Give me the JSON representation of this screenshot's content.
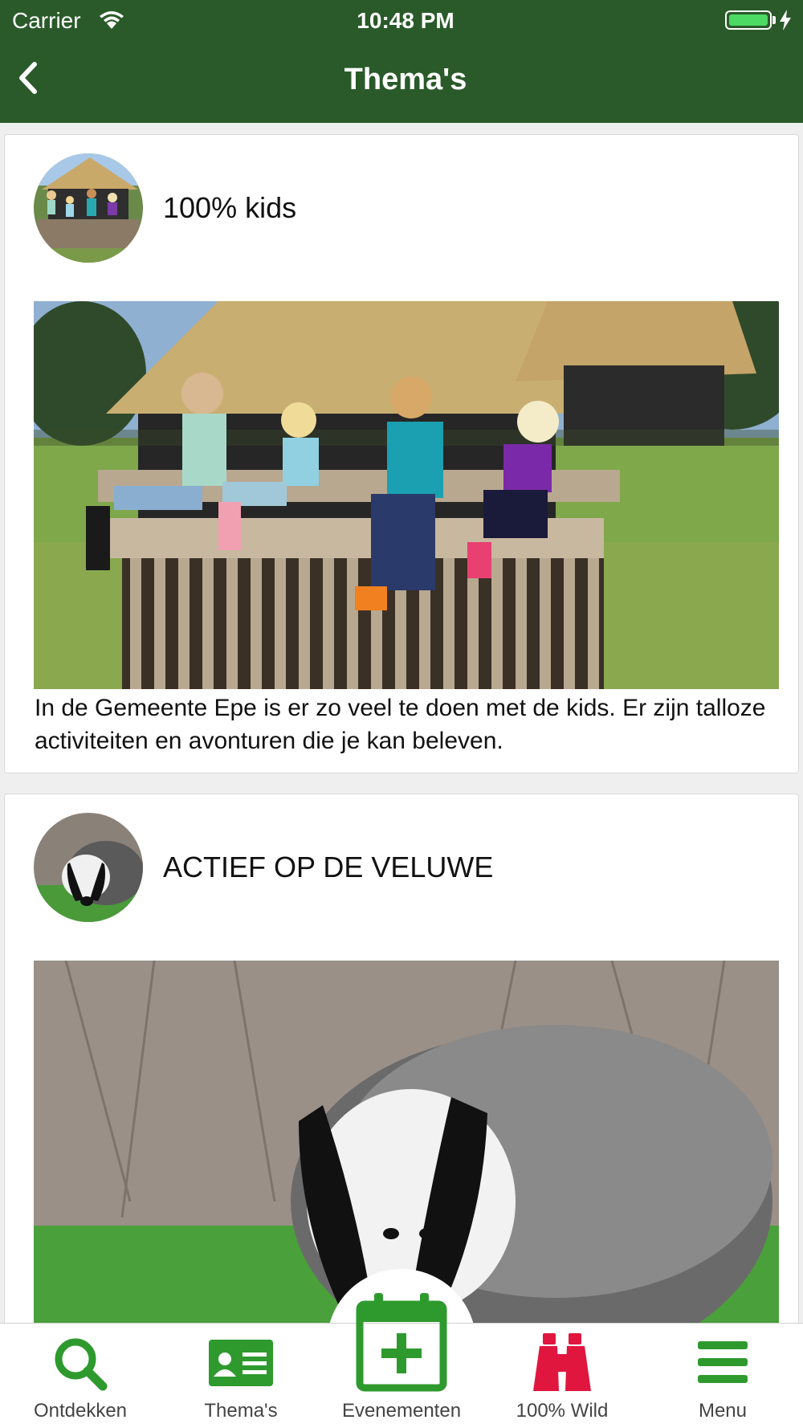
{
  "status_bar": {
    "carrier": "Carrier",
    "time": "10:48 PM",
    "battery_level": 1.0
  },
  "nav": {
    "title": "Thema's",
    "back_icon": "chevron-left-icon"
  },
  "cards": [
    {
      "title": "100% kids",
      "description": "In de Gemeente Epe is er zo veel te doen met de kids. Er zijn talloze activiteiten en avonturen die je kan beleven.",
      "image": "kids-on-fence-photo"
    },
    {
      "title": "ACTIEF OP DE VELUWE",
      "description": "",
      "image": "badger-photo"
    }
  ],
  "tabs": [
    {
      "label": "Ontdekken",
      "icon": "search-icon",
      "color": "#2e9a2e"
    },
    {
      "label": "Thema's",
      "icon": "id-card-icon",
      "color": "#2e9a2e"
    },
    {
      "label": "Evenementen",
      "icon": "calendar-plus-icon",
      "color": "#2e9a2e"
    },
    {
      "label": "100% Wild",
      "icon": "binoculars-icon",
      "color": "#e0163f"
    },
    {
      "label": "Menu",
      "icon": "hamburger-menu-icon",
      "color": "#2e9a2e"
    }
  ],
  "colors": {
    "header_bg": "#2a5a2a",
    "accent_green": "#2e9a2e",
    "wild_red": "#e0163f"
  }
}
